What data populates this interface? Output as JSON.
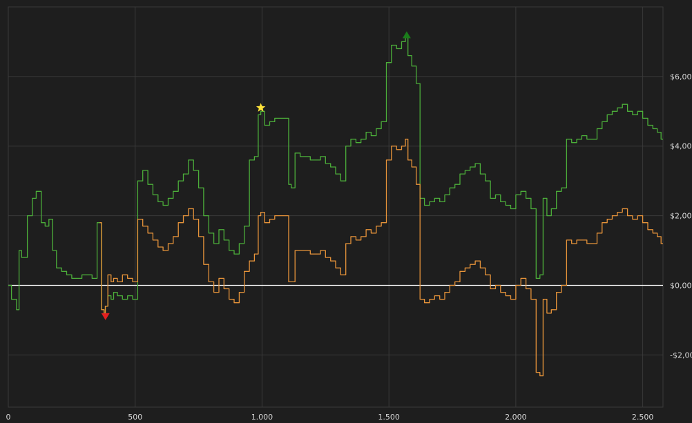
{
  "chart_data": {
    "type": "line",
    "title": "",
    "xlabel": "",
    "ylabel": "",
    "xlim": [
      0,
      2580
    ],
    "ylim": [
      -3.5,
      8.0
    ],
    "x_ticks": [
      0,
      500,
      1000,
      1500,
      2000,
      2500
    ],
    "x_tick_labels": [
      "0",
      "500",
      "1.000",
      "1.500",
      "2.000",
      "2.500"
    ],
    "y_ticks": [
      -2,
      0,
      2,
      4,
      6
    ],
    "y_tick_labels": [
      "-$2,00",
      "$0,00",
      "$2,00",
      "$4,00",
      "$6,00"
    ],
    "grid": true,
    "colors": {
      "background": "#1e1e1e",
      "grid": "#3a3a3a",
      "zero_line": "#ffffff",
      "series_green": "#4caf3a",
      "series_orange": "#e8943a",
      "marker_min": "#e32020",
      "marker_max": "#1a7d1a",
      "marker_star": "#ffe33a"
    },
    "series": [
      {
        "color": "#4caf3a",
        "x": [
          0,
          25,
          40,
          45,
          60,
          90,
          100,
          120,
          140,
          150,
          170,
          180,
          200,
          220,
          240,
          260,
          280,
          300,
          320,
          340,
          360,
          375,
          380,
          385,
          400,
          410,
          420,
          440,
          460,
          480,
          500,
          520,
          540,
          560,
          580,
          600,
          620,
          640,
          660,
          680,
          700,
          720,
          740,
          760,
          780,
          800,
          820,
          840,
          860,
          880,
          900,
          920,
          940,
          960,
          980,
          990,
          1000,
          1020,
          1040,
          1060,
          1080,
          1100,
          1110,
          1120,
          1140,
          1160,
          1180,
          1200,
          1220,
          1240,
          1260,
          1280,
          1300,
          1320,
          1340,
          1360,
          1380,
          1400,
          1420,
          1440,
          1460,
          1480,
          1500,
          1520,
          1540,
          1560,
          1570,
          1580,
          1600,
          1615,
          1630,
          1650,
          1670,
          1690,
          1710,
          1730,
          1750,
          1770,
          1790,
          1810,
          1830,
          1850,
          1870,
          1890,
          1910,
          1930,
          1950,
          1970,
          1990,
          2010,
          2030,
          2050,
          2070,
          2090,
          2100,
          2115,
          2130,
          2150,
          2170,
          2190,
          2210,
          2230,
          2250,
          2270,
          2290,
          2310,
          2330,
          2350,
          2370,
          2390,
          2410,
          2430,
          2450,
          2470,
          2490,
          2510,
          2530,
          2550,
          2565,
          2580
        ],
        "values": [
          0.0,
          -0.4,
          -0.7,
          1.0,
          0.8,
          2.0,
          2.5,
          2.7,
          1.8,
          1.7,
          1.9,
          1.0,
          0.5,
          0.4,
          0.3,
          0.2,
          0.2,
          0.3,
          0.3,
          0.2,
          1.8,
          -0.7,
          -0.8,
          -0.6,
          -0.3,
          -0.4,
          -0.2,
          -0.3,
          -0.4,
          -0.3,
          -0.4,
          3.0,
          3.3,
          2.9,
          2.6,
          2.4,
          2.3,
          2.5,
          2.7,
          3.0,
          3.2,
          3.6,
          3.3,
          2.8,
          2.0,
          1.5,
          1.2,
          1.6,
          1.3,
          1.0,
          0.9,
          1.2,
          1.7,
          3.6,
          3.7,
          4.9,
          5.0,
          4.6,
          4.7,
          4.8,
          4.8,
          4.8,
          2.9,
          2.8,
          3.8,
          3.7,
          3.7,
          3.6,
          3.6,
          3.7,
          3.5,
          3.4,
          3.2,
          3.0,
          4.0,
          4.2,
          4.1,
          4.2,
          4.4,
          4.3,
          4.5,
          4.7,
          6.4,
          6.9,
          6.8,
          7.0,
          7.2,
          6.6,
          6.3,
          5.8,
          2.5,
          2.3,
          2.4,
          2.5,
          2.4,
          2.6,
          2.8,
          2.9,
          3.2,
          3.3,
          3.4,
          3.5,
          3.2,
          3.0,
          2.5,
          2.6,
          2.4,
          2.3,
          2.2,
          2.6,
          2.7,
          2.5,
          2.2,
          0.2,
          0.3,
          2.5,
          2.0,
          2.2,
          2.7,
          2.8,
          4.2,
          4.1,
          4.2,
          4.3,
          4.2,
          4.2,
          4.5,
          4.7,
          4.9,
          5.0,
          5.1,
          5.2,
          5.0,
          4.9,
          5.0,
          4.8,
          4.6,
          4.5,
          4.4,
          4.2
        ]
      },
      {
        "color": "#e8943a",
        "x": [
          360,
          375,
          380,
          385,
          400,
          410,
          420,
          440,
          460,
          480,
          500,
          520,
          540,
          560,
          580,
          600,
          620,
          640,
          660,
          680,
          700,
          720,
          740,
          760,
          780,
          800,
          820,
          840,
          860,
          880,
          900,
          920,
          940,
          960,
          980,
          990,
          1000,
          1020,
          1040,
          1060,
          1080,
          1100,
          1110,
          1120,
          1140,
          1160,
          1180,
          1200,
          1220,
          1240,
          1260,
          1280,
          1300,
          1320,
          1340,
          1360,
          1380,
          1400,
          1420,
          1440,
          1460,
          1480,
          1500,
          1520,
          1540,
          1560,
          1570,
          1580,
          1600,
          1615,
          1630,
          1650,
          1670,
          1690,
          1710,
          1730,
          1750,
          1770,
          1790,
          1810,
          1830,
          1850,
          1870,
          1890,
          1910,
          1930,
          1950,
          1970,
          1990,
          2010,
          2030,
          2050,
          2070,
          2090,
          2100,
          2115,
          2130,
          2150,
          2170,
          2190,
          2210,
          2230,
          2250,
          2270,
          2290,
          2310,
          2330,
          2350,
          2370,
          2390,
          2410,
          2430,
          2450,
          2470,
          2490,
          2510,
          2530,
          2550,
          2565,
          2580
        ],
        "values": [
          1.8,
          -0.7,
          -0.8,
          -0.6,
          0.3,
          0.1,
          0.2,
          0.1,
          0.3,
          0.2,
          0.1,
          1.9,
          1.7,
          1.5,
          1.3,
          1.1,
          1.0,
          1.2,
          1.4,
          1.8,
          2.0,
          2.2,
          1.9,
          1.4,
          0.6,
          0.1,
          -0.2,
          0.2,
          -0.1,
          -0.4,
          -0.5,
          -0.2,
          0.4,
          0.7,
          0.9,
          2.0,
          2.1,
          1.8,
          1.9,
          2.0,
          2.0,
          2.0,
          0.1,
          0.1,
          1.0,
          1.0,
          1.0,
          0.9,
          0.9,
          1.0,
          0.8,
          0.7,
          0.5,
          0.3,
          1.2,
          1.4,
          1.3,
          1.4,
          1.6,
          1.5,
          1.7,
          1.8,
          3.6,
          4.0,
          3.9,
          4.0,
          4.2,
          3.6,
          3.4,
          2.9,
          -0.4,
          -0.5,
          -0.4,
          -0.3,
          -0.4,
          -0.2,
          0.0,
          0.1,
          0.4,
          0.5,
          0.6,
          0.7,
          0.5,
          0.3,
          -0.1,
          0.0,
          -0.2,
          -0.3,
          -0.4,
          0.0,
          0.2,
          -0.1,
          -0.4,
          -2.5,
          -2.6,
          -0.4,
          -0.8,
          -0.7,
          -0.2,
          0.0,
          1.3,
          1.2,
          1.3,
          1.3,
          1.2,
          1.2,
          1.5,
          1.8,
          1.9,
          2.0,
          2.1,
          2.2,
          2.0,
          1.9,
          2.0,
          1.8,
          1.6,
          1.5,
          1.4,
          1.2
        ]
      }
    ],
    "markers": [
      {
        "shape": "triangle-down",
        "x": 383,
        "y": -0.9,
        "color": "#e32020"
      },
      {
        "shape": "star",
        "x": 995,
        "y": 5.1,
        "color": "#ffe33a"
      },
      {
        "shape": "triangle-up",
        "x": 1570,
        "y": 7.2,
        "color": "#1a7d1a"
      }
    ]
  }
}
